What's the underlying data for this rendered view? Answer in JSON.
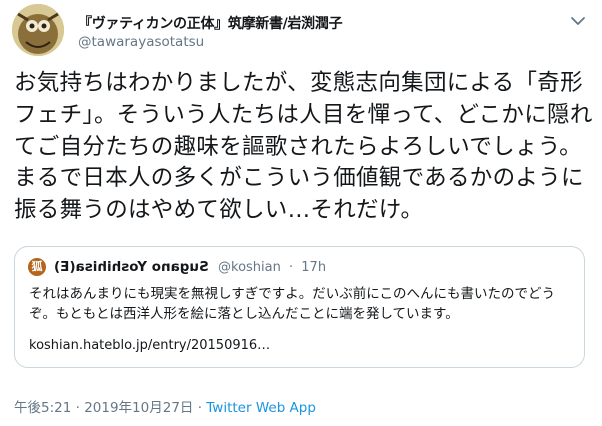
{
  "tweet": {
    "author": {
      "display_name": "『ヴァティカンの正体』筑摩新書/岩渕潤子",
      "handle": "@tawarayasotatsu"
    },
    "text": "お気持ちはわかりましたが、変態志向集団による「奇形フェチ」。そういう人たちは人目を憚って、どこかに隠れてご自分たちの趣味を謳歌されたらよろしいでしょう。まるで日本人の多くがこういう価値観であるかのように振る舞うのはやめて欲しい…それだけ。",
    "quote": {
      "avatar_glyph": "狐",
      "name": "Sugano Yoshihisa(E)",
      "handle": "@koshian",
      "separator": "·",
      "age": "17h",
      "text": "それはあんまりにも現実を無視しすぎですよ。だいぶ前にこのへんにも書いたのでどうぞ。もともとは西洋人形を絵に落とし込んだことに端を発しています。",
      "link": "koshian.hateblo.jp/entry/20150916…"
    },
    "footer": {
      "time": "午後5:21",
      "separator": " · ",
      "date": "2019年10月27日",
      "separator2": " · ",
      "app": "Twitter Web App"
    }
  },
  "icons": {
    "menu": "chevron-down-icon"
  }
}
